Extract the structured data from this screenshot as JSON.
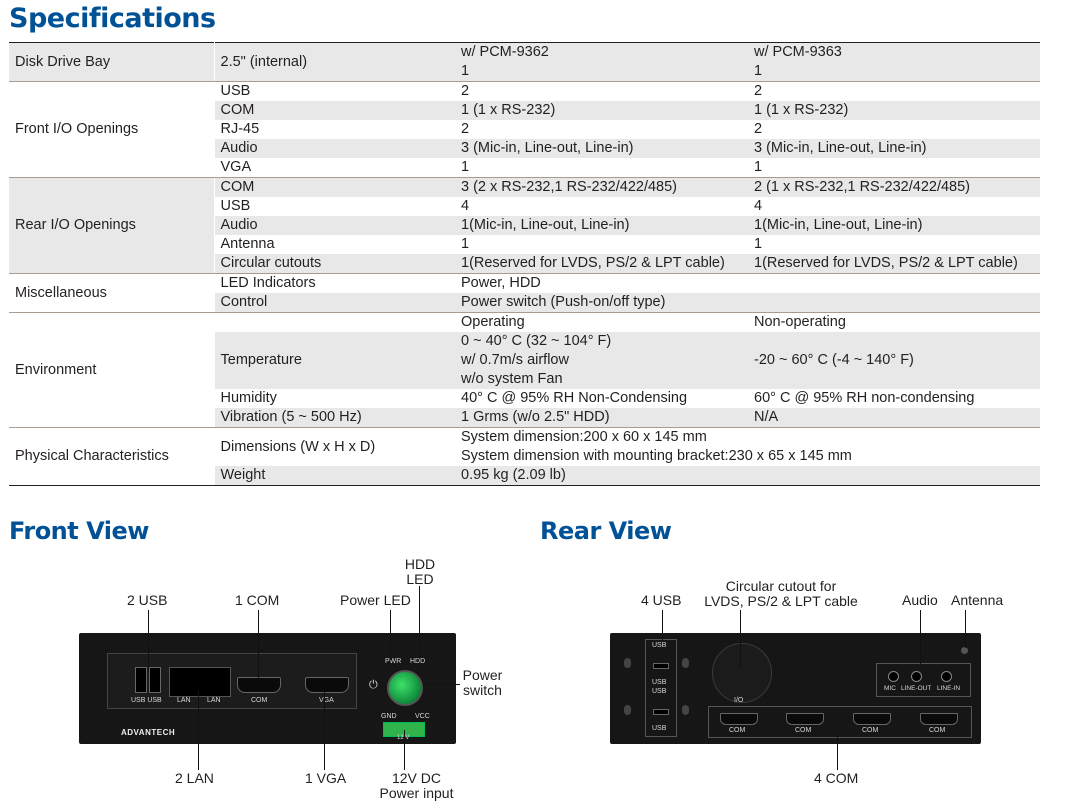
{
  "titles": {
    "specifications": "Specifications",
    "front_view": "Front View",
    "rear_view": "Rear View"
  },
  "specs": {
    "disk_drive_bay": {
      "category": "Disk Drive Bay",
      "value": "2.5\" (internal)",
      "col_a": [
        "w/ PCM-9362",
        "1"
      ],
      "col_b": [
        "w/ PCM-9363",
        "1"
      ]
    },
    "front_io": {
      "category": "Front I/O Openings",
      "rows": [
        {
          "label": "USB",
          "a": "2",
          "b": "2"
        },
        {
          "label": "COM",
          "a": "1 (1 x RS-232)",
          "b": "1 (1 x RS-232)"
        },
        {
          "label": "RJ-45",
          "a": "2",
          "b": "2"
        },
        {
          "label": "Audio",
          "a": "3 (Mic-in, Line-out, Line-in)",
          "b": "3 (Mic-in, Line-out, Line-in)"
        },
        {
          "label": "VGA",
          "a": "1",
          "b": "1"
        }
      ]
    },
    "rear_io": {
      "category": "Rear I/O Openings",
      "rows": [
        {
          "label": "COM",
          "a": "3 (2 x RS-232,1 RS-232/422/485)",
          "b": "2 (1 x RS-232,1 RS-232/422/485)"
        },
        {
          "label": "USB",
          "a": "4",
          "b": "4"
        },
        {
          "label": "Audio",
          "a": "1(Mic-in, Line-out, Line-in)",
          "b": "1(Mic-in, Line-out, Line-in)"
        },
        {
          "label": "Antenna",
          "a": "1",
          "b": "1"
        },
        {
          "label": "Circular cutouts",
          "a": "1(Reserved for LVDS, PS/2 & LPT cable)",
          "b": "1(Reserved for LVDS, PS/2 & LPT cable)"
        }
      ]
    },
    "misc": {
      "category": "Miscellaneous",
      "rows": [
        {
          "label": "LED Indicators",
          "value": "Power, HDD"
        },
        {
          "label": "Control",
          "value": "Power switch (Push-on/off type)"
        }
      ]
    },
    "environment": {
      "category": "Environment",
      "operating": "Operating",
      "non_operating": "Non-operating",
      "temperature_label": "Temperature",
      "temp_operating": [
        "0 ~ 40° C (32 ~ 104° F)",
        "w/ 0.7m/s airflow",
        "w/o system Fan"
      ],
      "temp_non_operating": "-20 ~ 60° C (-4 ~ 140° F)",
      "humidity_label": "Humidity",
      "humidity_a": "40° C @ 95% RH Non-Condensing",
      "humidity_b": "60° C @ 95% RH non-condensing",
      "vibration_label": "Vibration (5 ~ 500 Hz)",
      "vibration_a": "1 Grms (w/o 2.5\" HDD)",
      "vibration_b": "N/A"
    },
    "physical": {
      "category": "Physical Characteristics",
      "dimensions_label": "Dimensions (W x H x D)",
      "dimensions": [
        "System dimension:200 x 60 x 145 mm",
        "System dimension with mounting bracket:230 x 65 x 145 mm"
      ],
      "weight_label": "Weight",
      "weight": "0.95 kg (2.09 lb)"
    }
  },
  "front": {
    "callouts": {
      "usb": "2 USB",
      "com": "1 COM",
      "power_led": "Power LED",
      "hdd_led": [
        "HDD",
        "LED"
      ],
      "power_switch": [
        "Power",
        "switch"
      ],
      "lan": "2 LAN",
      "vga": "1 VGA",
      "dc": [
        "12V DC",
        "Power input"
      ]
    },
    "panel_labels": {
      "usb": "USB USB",
      "lan1": "LAN",
      "lan2": "LAN",
      "com": "COM",
      "vga": "VGA",
      "pwr": "PWR",
      "hdd": "HDD",
      "gnd": "GND",
      "vcc": "VCC",
      "v12": "12 V",
      "brand": "ADVANTECH"
    }
  },
  "rear": {
    "callouts": {
      "usb": "4 USB",
      "circular": [
        "Circular cutout for",
        "LVDS, PS/2 & LPT cable"
      ],
      "audio": "Audio",
      "antenna": "Antenna",
      "com": "4 COM"
    },
    "panel_labels": {
      "usb": [
        "USB",
        "USB",
        "USB",
        "USB"
      ],
      "io": "I/O",
      "mic": "MIC",
      "line_out": "LINE-OUT",
      "line_in": "LINE-IN",
      "com": [
        "COM",
        "COM",
        "COM",
        "COM"
      ]
    }
  }
}
